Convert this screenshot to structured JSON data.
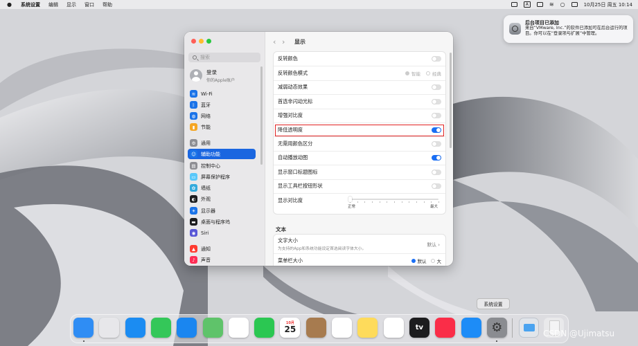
{
  "menubar": {
    "items": [
      "系统设置",
      "编辑",
      "显示",
      "窗口",
      "帮助"
    ],
    "clock": "10月25日 周五 10:14",
    "input_indicator": "A"
  },
  "notification": {
    "title": "后台项目已添加",
    "body": "来自“VMware, Inc.”的软件已添加可在后台运行的项目。你可以在“登录项与扩展”中管理。"
  },
  "window": {
    "title": "显示",
    "sidebar": {
      "search_placeholder": "搜索",
      "account_name": "登录",
      "account_sub": "你的Apple账户",
      "items": [
        {
          "label": "Wi-Fi",
          "icon": "wifi-icon",
          "color": "#1a73e8"
        },
        {
          "label": "蓝牙",
          "icon": "bluetooth-icon",
          "color": "#1a73e8"
        },
        {
          "label": "网络",
          "icon": "network-icon",
          "color": "#1a73e8"
        },
        {
          "label": "节能",
          "icon": "battery-icon",
          "color": "#f5a623"
        },
        {
          "label": "通用",
          "icon": "gear-icon",
          "color": "#8e8e93"
        },
        {
          "label": "辅助功能",
          "icon": "accessibility-icon",
          "color": "#1a73e8"
        },
        {
          "label": "控制中心",
          "icon": "control-center-icon",
          "color": "#8e8e93"
        },
        {
          "label": "屏幕保护程序",
          "icon": "screensaver-icon",
          "color": "#5ac8fa"
        },
        {
          "label": "墙纸",
          "icon": "wallpaper-icon",
          "color": "#34aadc"
        },
        {
          "label": "外观",
          "icon": "appearance-icon",
          "color": "#1c1c1e"
        },
        {
          "label": "显示器",
          "icon": "display-icon",
          "color": "#1a73e8"
        },
        {
          "label": "桌面与程序坞",
          "icon": "dock-icon",
          "color": "#1c1c1e"
        },
        {
          "label": "Siri",
          "icon": "siri-icon",
          "color": "#5856d6"
        },
        {
          "label": "通知",
          "icon": "bell-icon",
          "color": "#ff3b30"
        },
        {
          "label": "声音",
          "icon": "speaker-icon",
          "color": "#ff2d55"
        }
      ],
      "selected_index": 5
    },
    "settings": [
      {
        "label": "反转颜色",
        "type": "toggle",
        "on": false
      },
      {
        "label": "反转颜色模式",
        "type": "radio",
        "options": [
          "智能",
          "经典"
        ],
        "selected": "智能"
      },
      {
        "label": "减弱动态效果",
        "type": "toggle",
        "on": false
      },
      {
        "label": "首选非闪动光标",
        "type": "toggle",
        "on": false
      },
      {
        "label": "增强对比度",
        "type": "toggle",
        "on": false
      },
      {
        "label": "降低透明度",
        "type": "toggle",
        "on": true,
        "highlighted": true
      },
      {
        "label": "无需用颜色区分",
        "type": "toggle",
        "on": false
      },
      {
        "label": "自动播放动图",
        "type": "toggle",
        "on": true
      },
      {
        "label": "显示窗口标题图标",
        "type": "toggle",
        "on": false
      },
      {
        "label": "显示工具栏按钮形状",
        "type": "toggle",
        "on": false
      },
      {
        "label": "显示对比度",
        "type": "slider",
        "min_label": "正常",
        "max_label": "最大",
        "value": 0
      }
    ],
    "text_section": {
      "heading": "文本",
      "text_size_label": "文字大小",
      "text_size_desc": "为支持的App和系统功能设定首选阅读字体大小。",
      "text_size_value": "默认",
      "menubar_size_label": "菜单栏大小",
      "menubar_options": [
        "默认",
        "大"
      ],
      "menubar_selected": "默认"
    }
  },
  "dock": {
    "tooltip": "系统设置",
    "calendar_month": "10月",
    "calendar_day": "25",
    "apps": [
      {
        "name": "finder-app",
        "color": "#2f8df4",
        "running": true
      },
      {
        "name": "launchpad-app",
        "color": "#e7e7ea",
        "running": false
      },
      {
        "name": "safari-app",
        "color": "#1b8cf2",
        "running": false
      },
      {
        "name": "messages-app",
        "color": "#34c759",
        "running": false
      },
      {
        "name": "mail-app",
        "color": "#1a86f0",
        "running": false
      },
      {
        "name": "maps-app",
        "color": "#5fc36a",
        "running": false
      },
      {
        "name": "photos-app",
        "color": "#ffffff",
        "running": false
      },
      {
        "name": "facetime-app",
        "color": "#2bc752",
        "running": false
      },
      {
        "name": "calendar-app",
        "color": "#ffffff",
        "running": false
      },
      {
        "name": "contacts-app",
        "color": "#a77b4f",
        "running": false
      },
      {
        "name": "reminders-app",
        "color": "#ffffff",
        "running": false
      },
      {
        "name": "notes-app",
        "color": "#fedb5b",
        "running": false
      },
      {
        "name": "freeform-app",
        "color": "#ffffff",
        "running": false
      },
      {
        "name": "tv-app",
        "color": "#1c1c1e",
        "running": false
      },
      {
        "name": "music-app",
        "color": "#fa2d48",
        "running": false
      },
      {
        "name": "app-store-app",
        "color": "#1d8cf7",
        "running": false
      },
      {
        "name": "system-settings-app",
        "color": "#8a8c91",
        "running": true
      }
    ],
    "tv_label": "tv",
    "watermark": "CSDN @Ujimatsu"
  }
}
